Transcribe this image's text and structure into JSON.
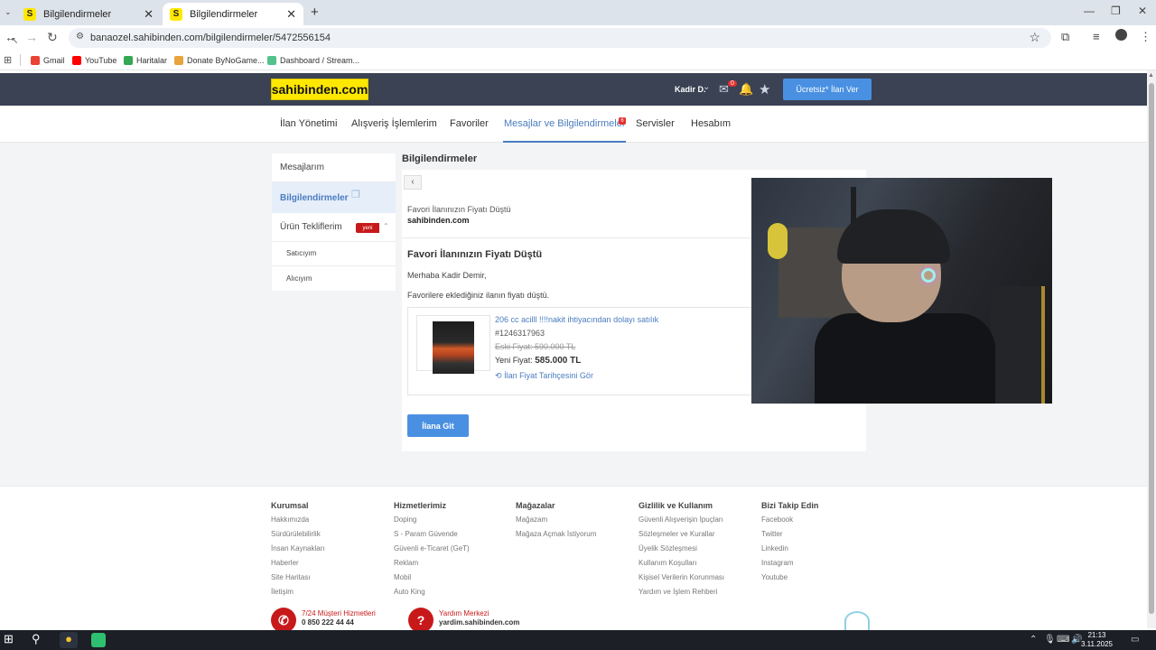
{
  "browser": {
    "tabs": [
      {
        "label": "Bilgilendirmeler",
        "favicon": "S",
        "active": false
      },
      {
        "label": "Bilgilendirmeler",
        "favicon": "S",
        "active": true
      }
    ],
    "url": "banaozel.sahibinden.com/bilgilendirmeler/5472556154",
    "bookmarks": [
      {
        "label": "Gmail",
        "color": "#ea4335"
      },
      {
        "label": "YouTube",
        "color": "#ff0000"
      },
      {
        "label": "Haritalar",
        "color": "#34a853"
      },
      {
        "label": "Donate ByNoGame...",
        "color": "#e6a43a"
      },
      {
        "label": "Dashboard / Stream...",
        "color": "#53c28b"
      }
    ]
  },
  "site": {
    "logo": "sahibinden.com",
    "user": "Kadir D.",
    "mail_badge": "0",
    "post_button": "Ücretsiz* İlan Ver",
    "nav": [
      {
        "label": "İlan Yönetimi"
      },
      {
        "label": "Alışveriş İşlemlerim"
      },
      {
        "label": "Favoriler"
      },
      {
        "label": "Mesajlar ve Bilgilendirmeler",
        "badge": "6",
        "active": true
      },
      {
        "label": "Servisler"
      },
      {
        "label": "Hesabım"
      }
    ]
  },
  "left_menu": {
    "items": [
      {
        "label": "Mesajlarım"
      },
      {
        "label": "Bilgilendirmeler",
        "active": true
      },
      {
        "label": "Ürün Tekliflerim",
        "badge": "yeni"
      }
    ],
    "sub_items": [
      {
        "label": "Satıcıyım"
      },
      {
        "label": "Alıcıyım"
      }
    ]
  },
  "content": {
    "section_title": "Bilgilendirmeler",
    "message_subject": "Favori İlanınızın Fiyatı Düştü",
    "message_sender": "sahibinden.com",
    "message_title": "Favori İlanınızın Fiyatı Düştü",
    "greeting": "Merhaba Kadir Demir,",
    "body": "Favorilere eklediğiniz ilanın fiyatı düştü.",
    "product": {
      "title": "206 cc acilll !!!!nakit ihtiyacından dolayı satılık",
      "id": "#1246317963",
      "old_price": "Eski Fiyat: 590.000 TL",
      "new_price_label": "Yeni Fiyat:",
      "new_price": "585.000 TL",
      "history_link": "İlan Fiyat Tarihçesini Gör"
    },
    "go_button": "İlana Git"
  },
  "footer": {
    "columns": [
      {
        "title": "Kurumsal",
        "links": [
          "Hakkımızda",
          "Sürdürülebilirlik",
          "İnsan Kaynakları",
          "Haberler",
          "Site Haritası",
          "İletişim"
        ]
      },
      {
        "title": "Hizmetlerimiz",
        "links": [
          "Doping",
          "S - Param Güvende",
          "Güvenli e-Ticaret (GeT)",
          "Reklam",
          "Mobil",
          "Auto King"
        ]
      },
      {
        "title": "Mağazalar",
        "links": [
          "Mağazam",
          "Mağaza Açmak İstiyorum"
        ]
      },
      {
        "title": "Gizlilik ve Kullanım",
        "links": [
          "Güvenli Alışverişin İpuçları",
          "Sözleşmeler ve Kurallar",
          "Üyelik Sözleşmesi",
          "Kullanım Koşulları",
          "Kişisel Verilerin Korunması",
          "Yardım ve İşlem Rehberi"
        ]
      },
      {
        "title": "Bizi Takip Edin",
        "links": [
          "Facebook",
          "Twitter",
          "Linkedin",
          "Instagram",
          "Youtube"
        ]
      }
    ],
    "support": [
      {
        "line1": "7/24 Müşteri Hizmetleri",
        "line2": "0 850 222 44 44"
      },
      {
        "line1": "Yardım Merkezi",
        "line2": "yardim.sahibinden.com"
      }
    ]
  },
  "taskbar": {
    "time": "21:13",
    "date": "3.11.2025"
  }
}
